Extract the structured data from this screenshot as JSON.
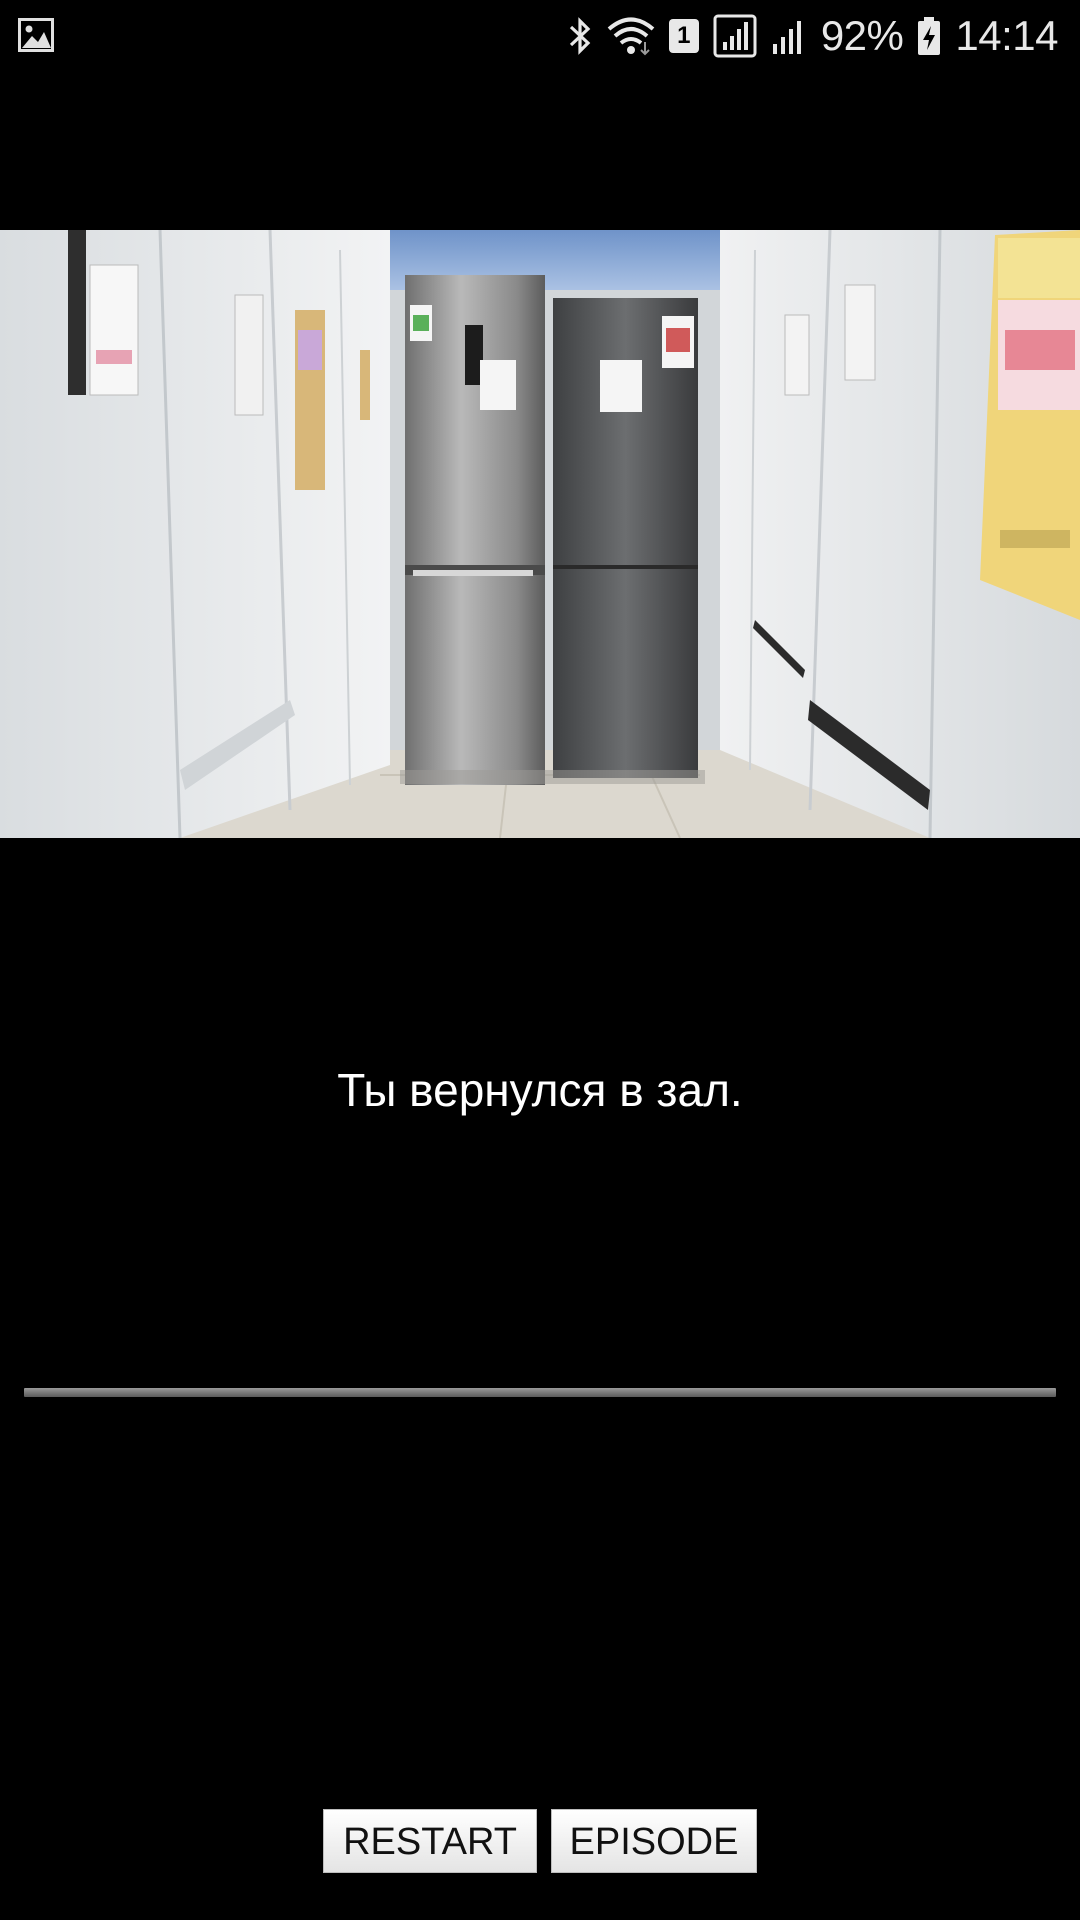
{
  "status_bar": {
    "left_icon": "image-notification-icon",
    "icons": [
      "bluetooth-icon",
      "wifi-icon",
      "sim-slot-icon",
      "signal-icon",
      "signal-icon-2",
      "battery-charging-icon"
    ],
    "sim_number": "1",
    "battery_percent": "92%",
    "time": "14:14"
  },
  "scene": {
    "image": "store-aisle-refrigerators"
  },
  "narration": {
    "text": "Ты вернулся в зал."
  },
  "buttons": {
    "restart_label": "RESTART",
    "episode_label": "EPISODE"
  },
  "colors": {
    "background": "#000000",
    "text": "#ffffff",
    "button_bg": "#f2f2f2",
    "divider": "#7a7a7a"
  }
}
